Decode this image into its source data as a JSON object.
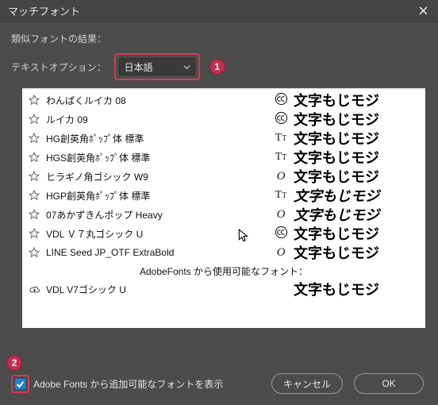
{
  "window": {
    "title": "マッチフォント"
  },
  "options": {
    "results_label": "類似フォントの結果：",
    "text_option_label": "テキストオプション：",
    "select_value": "日本語",
    "badge1": "1",
    "badge2": "2"
  },
  "list": {
    "items": [
      {
        "name": "わんぱくルイカ 08",
        "type": "cc"
      },
      {
        "name": "ルイカ 09",
        "type": "cc"
      },
      {
        "name": "HG創英角ﾎﾟｯﾌﾟ体 標準",
        "type": "Tr"
      },
      {
        "name": "HGS創英角ﾎﾟｯﾌﾟ体 標準",
        "type": "Tr"
      },
      {
        "name": "ヒラギノ角ゴシック W9",
        "type": "O"
      },
      {
        "name": "HGP創英角ﾎﾟｯﾌﾟ体 標準",
        "type": "Tr"
      },
      {
        "name": "07あかずきんポップ Heavy",
        "type": "O"
      },
      {
        "name": "VDL Ｖ７丸ゴシック U",
        "type": "cc"
      },
      {
        "name": "LINE Seed JP_OTF ExtraBold",
        "type": "O"
      }
    ],
    "section_label": "AdobeFonts から使用可能なフォント：",
    "cloud_items": [
      {
        "name": "VDL V7ゴシック U",
        "type": ""
      }
    ],
    "sample_text": "文字もじモジ"
  },
  "checkbox": {
    "label": "Adobe Fonts から追加可能なフォントを表示",
    "checked": true
  },
  "buttons": {
    "cancel": "キャンセル",
    "ok": "OK"
  }
}
